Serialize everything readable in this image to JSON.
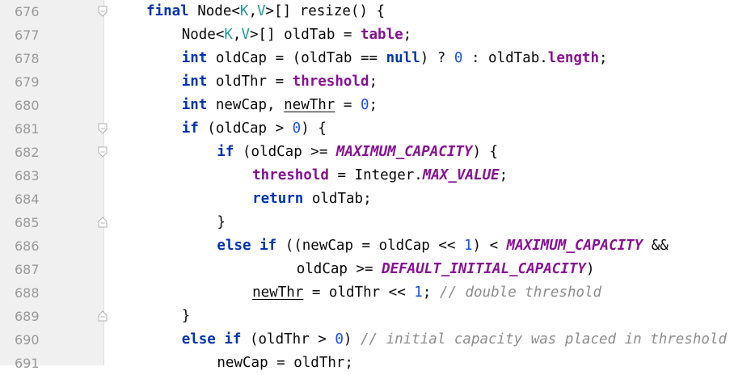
{
  "editor": {
    "lines": [
      {
        "num": "676",
        "fold": "down",
        "indent": 0,
        "tokens": [
          {
            "t": "final",
            "c": "kw"
          },
          {
            "t": " Node<"
          },
          {
            "t": "K",
            "c": "tparam"
          },
          {
            "t": ","
          },
          {
            "t": "V",
            "c": "tparam"
          },
          {
            "t": ">[] resize() {"
          }
        ]
      },
      {
        "num": "677",
        "fold": "",
        "indent": 1,
        "tokens": [
          {
            "t": "Node<"
          },
          {
            "t": "K",
            "c": "tparam"
          },
          {
            "t": ","
          },
          {
            "t": "V",
            "c": "tparam"
          },
          {
            "t": ">[] oldTab = "
          },
          {
            "t": "table",
            "c": "field"
          },
          {
            "t": ";"
          }
        ]
      },
      {
        "num": "678",
        "fold": "",
        "indent": 1,
        "tokens": [
          {
            "t": "int",
            "c": "kw"
          },
          {
            "t": " oldCap = (oldTab == "
          },
          {
            "t": "null",
            "c": "kw"
          },
          {
            "t": ") ? "
          },
          {
            "t": "0",
            "c": "num"
          },
          {
            "t": " : oldTab."
          },
          {
            "t": "length",
            "c": "field"
          },
          {
            "t": ";"
          }
        ]
      },
      {
        "num": "679",
        "fold": "",
        "indent": 1,
        "tokens": [
          {
            "t": "int",
            "c": "kw"
          },
          {
            "t": " oldThr = "
          },
          {
            "t": "threshold",
            "c": "field"
          },
          {
            "t": ";"
          }
        ]
      },
      {
        "num": "680",
        "fold": "",
        "indent": 1,
        "tokens": [
          {
            "t": "int",
            "c": "kw"
          },
          {
            "t": " newCap, "
          },
          {
            "t": "newThr",
            "c": "ul"
          },
          {
            "t": " = "
          },
          {
            "t": "0",
            "c": "num"
          },
          {
            "t": ";"
          }
        ]
      },
      {
        "num": "681",
        "fold": "down",
        "indent": 1,
        "tokens": [
          {
            "t": "if",
            "c": "kw"
          },
          {
            "t": " (oldCap > "
          },
          {
            "t": "0",
            "c": "num"
          },
          {
            "t": ") {"
          }
        ]
      },
      {
        "num": "682",
        "fold": "down",
        "indent": 2,
        "tokens": [
          {
            "t": "if",
            "c": "kw"
          },
          {
            "t": " (oldCap >= "
          },
          {
            "t": "MAXIMUM_CAPACITY",
            "c": "const"
          },
          {
            "t": ") {"
          }
        ]
      },
      {
        "num": "683",
        "fold": "",
        "indent": 3,
        "tokens": [
          {
            "t": "threshold",
            "c": "field"
          },
          {
            "t": " = Integer."
          },
          {
            "t": "MAX_VALUE",
            "c": "const"
          },
          {
            "t": ";"
          }
        ]
      },
      {
        "num": "684",
        "fold": "",
        "indent": 3,
        "tokens": [
          {
            "t": "return",
            "c": "kw"
          },
          {
            "t": " oldTab;"
          }
        ]
      },
      {
        "num": "685",
        "fold": "up",
        "indent": 2,
        "tokens": [
          {
            "t": "}"
          }
        ]
      },
      {
        "num": "686",
        "fold": "",
        "indent": 2,
        "tokens": [
          {
            "t": "else if",
            "c": "kw"
          },
          {
            "t": " ((newCap = oldCap << "
          },
          {
            "t": "1",
            "c": "num"
          },
          {
            "t": ") < "
          },
          {
            "t": "MAXIMUM_CAPACITY",
            "c": "const"
          },
          {
            "t": " &&"
          }
        ]
      },
      {
        "num": "687",
        "fold": "",
        "indent": 4.25,
        "tokens": [
          {
            "t": "oldCap >= "
          },
          {
            "t": "DEFAULT_INITIAL_CAPACITY",
            "c": "const"
          },
          {
            "t": ")"
          }
        ]
      },
      {
        "num": "688",
        "fold": "",
        "indent": 3,
        "tokens": [
          {
            "t": "newThr",
            "c": "ul"
          },
          {
            "t": " = oldThr << "
          },
          {
            "t": "1",
            "c": "num"
          },
          {
            "t": "; "
          },
          {
            "t": "// double threshold",
            "c": "comment"
          }
        ]
      },
      {
        "num": "689",
        "fold": "up",
        "indent": 1,
        "tokens": [
          {
            "t": "}"
          }
        ]
      },
      {
        "num": "690",
        "fold": "",
        "indent": 1,
        "tokens": [
          {
            "t": "else if",
            "c": "kw"
          },
          {
            "t": " (oldThr > "
          },
          {
            "t": "0",
            "c": "num"
          },
          {
            "t": ") "
          },
          {
            "t": "// initial capacity was placed in threshold",
            "c": "comment"
          }
        ]
      },
      {
        "num": "691",
        "fold": "",
        "indent": 2,
        "tokens": [
          {
            "t": "newCap = oldThr;"
          }
        ]
      }
    ]
  }
}
